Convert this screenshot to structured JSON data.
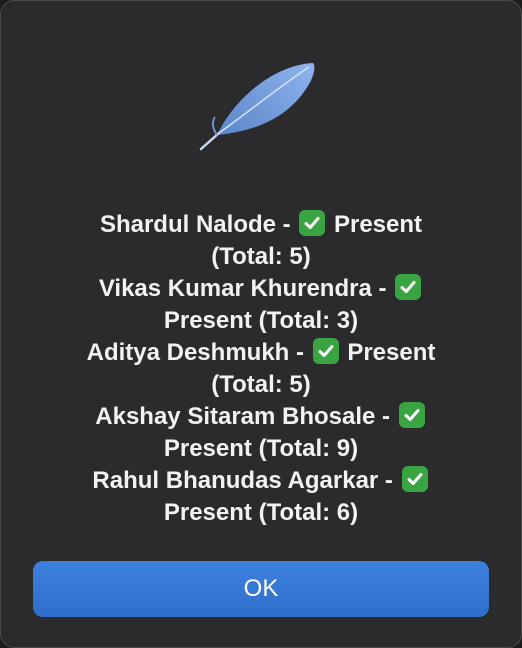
{
  "alert": {
    "icon": "feather-icon",
    "entries": [
      {
        "name": "Shardul Nalode",
        "separator": " - ",
        "status_icon": "check-mark-icon",
        "status": "Present",
        "total": "(Total: 5)"
      },
      {
        "name": "Vikas Kumar Khurendra",
        "separator": " - ",
        "status_icon": "check-mark-icon",
        "status": "Present",
        "total": "(Total: 3)"
      },
      {
        "name": "Aditya Deshmukh",
        "separator": " - ",
        "status_icon": "check-mark-icon",
        "status": "Present",
        "total": "(Total: 5)"
      },
      {
        "name": "Akshay Sitaram Bhosale",
        "separator": " - ",
        "status_icon": "check-mark-icon",
        "status": "Present",
        "total": "(Total: 9)"
      },
      {
        "name": "Rahul Bhanudas Agarkar",
        "separator": " - ",
        "status_icon": "check-mark-icon",
        "status": "Present",
        "total": "(Total: 6)"
      }
    ],
    "ok_label": "OK",
    "colors": {
      "background": "#2b2b2d",
      "button": "#3478d6",
      "check": "#3aa342"
    }
  }
}
